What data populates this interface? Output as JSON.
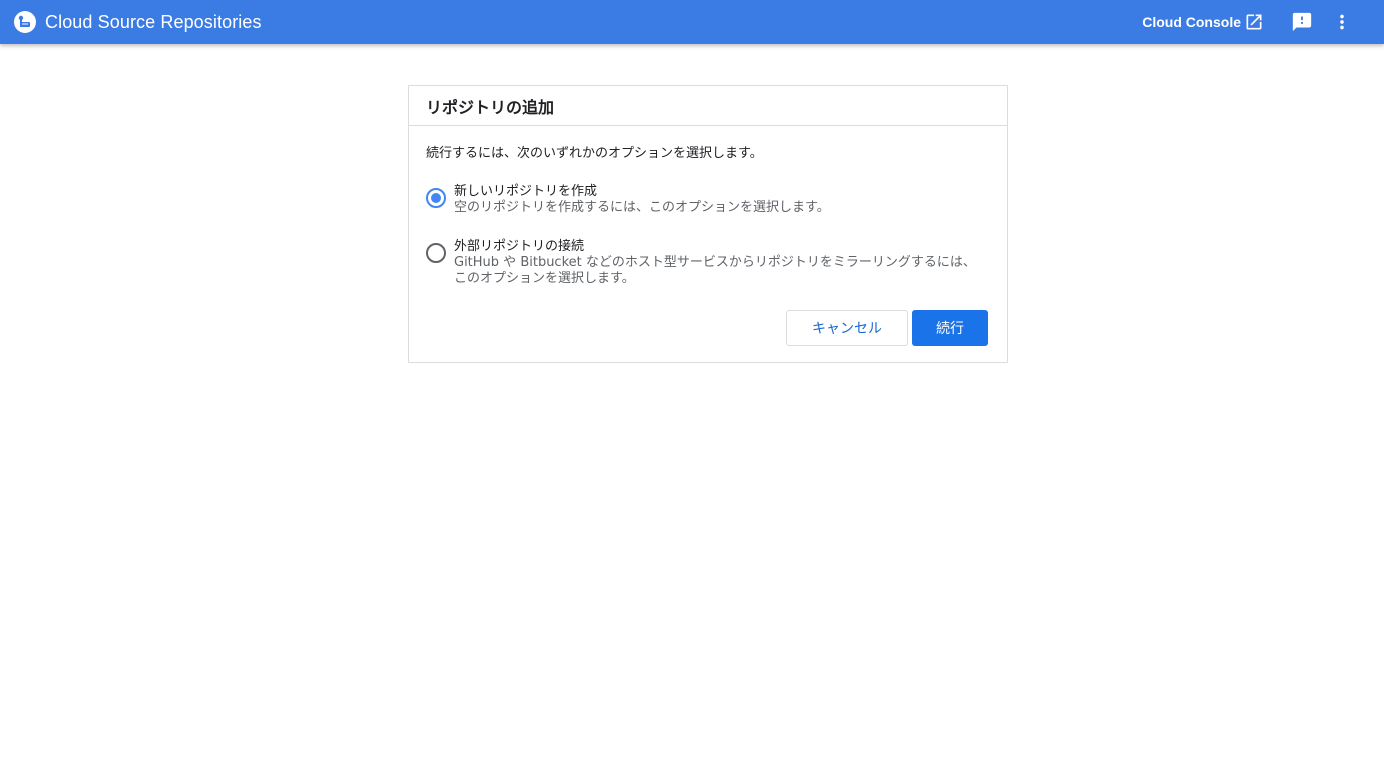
{
  "appbar": {
    "title": "Cloud Source Repositories",
    "console_link_label": "Cloud Console",
    "background_color": "#3b7be4",
    "icons": {
      "logo": "cloud-source-repositories-logo-icon",
      "console": "open-in-new-icon",
      "feedback": "feedback-icon",
      "more": "more-vert-icon"
    }
  },
  "dialog": {
    "title": "リポジトリの追加",
    "intro": "続行するには、次のいずれかのオプションを選択します。",
    "options": [
      {
        "label": "新しいリポジトリを作成",
        "description": "空のリポジトリを作成するには、このオプションを選択します。",
        "selected": true
      },
      {
        "label": "外部リポジトリの接続",
        "description": "GitHub や Bitbucket などのホスト型サービスからリポジトリをミラーリングするには、このオプションを選択します。",
        "selected": false
      }
    ],
    "cancel_label": "キャンセル",
    "continue_label": "続行",
    "accent_color": "#1a73e8"
  }
}
